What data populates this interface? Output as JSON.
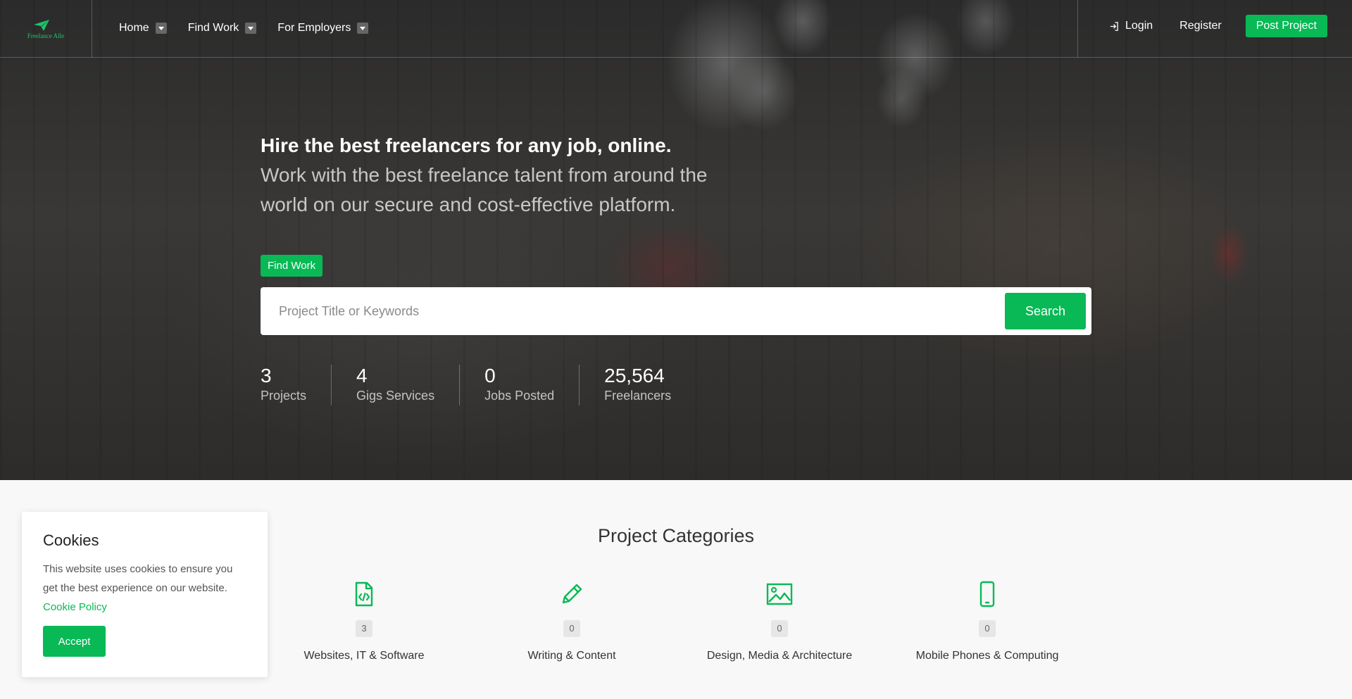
{
  "brand": {
    "name": "Freelance Alle",
    "accent": "#08b956"
  },
  "nav": {
    "items": [
      {
        "label": "Home"
      },
      {
        "label": "Find Work"
      },
      {
        "label": "For Employers"
      }
    ],
    "login": "Login",
    "register": "Register",
    "post_project": "Post Project"
  },
  "hero": {
    "headline": "Hire the best freelancers for any job, online.",
    "subline": "Work with the best freelance talent from around the world on our secure and cost-effective platform.",
    "find_work": "Find Work",
    "search": {
      "placeholder": "Project Title or Keywords",
      "button": "Search"
    },
    "stats": [
      {
        "value": "3",
        "label": "Projects"
      },
      {
        "value": "4",
        "label": "Gigs Services"
      },
      {
        "value": "0",
        "label": "Jobs Posted"
      },
      {
        "value": "25,564",
        "label": "Freelancers"
      }
    ]
  },
  "categories": {
    "title": "Project Categories",
    "items": [
      {
        "icon": "code-file-icon",
        "count": "3",
        "name": "Websites, IT & Software"
      },
      {
        "icon": "pencil-icon",
        "count": "0",
        "name": "Writing & Content"
      },
      {
        "icon": "image-icon",
        "count": "0",
        "name": "Design, Media & Architecture"
      },
      {
        "icon": "mobile-phone-icon",
        "count": "0",
        "name": "Mobile Phones & Computing"
      }
    ]
  },
  "cookie": {
    "title": "Cookies",
    "text": "This website uses cookies to ensure you get the best experience on our website.",
    "link": "Cookie Policy",
    "accept": "Accept"
  }
}
